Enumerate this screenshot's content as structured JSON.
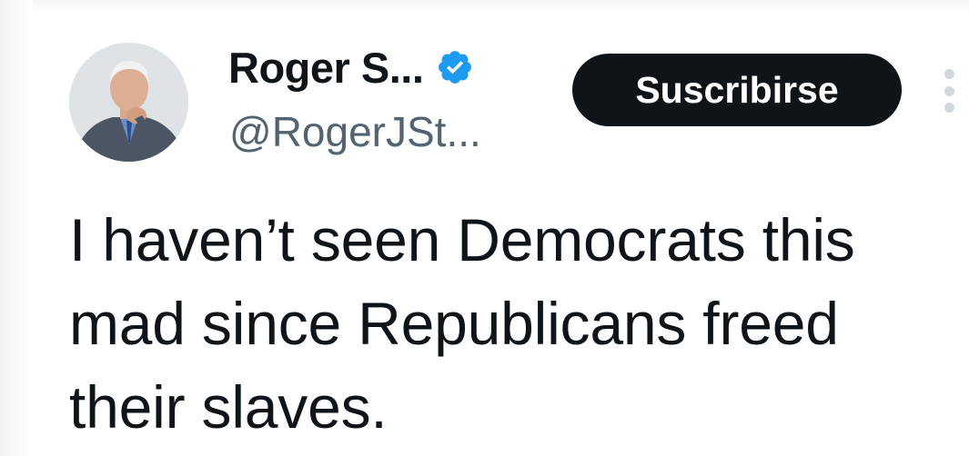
{
  "author": {
    "display_name": "Roger S...",
    "handle": "@RogerJSt...",
    "verified": true,
    "verified_color": "#1d9bf0"
  },
  "actions": {
    "subscribe_label": "Suscribirse",
    "more_icon": "more-vertical-icon"
  },
  "tweet": {
    "text": "I haven’t seen Democrats this mad since Republicans freed their slaves."
  },
  "colors": {
    "primary_text": "#0f1419",
    "secondary_text": "#536471",
    "button_bg": "#0f1419",
    "button_text": "#ffffff"
  }
}
